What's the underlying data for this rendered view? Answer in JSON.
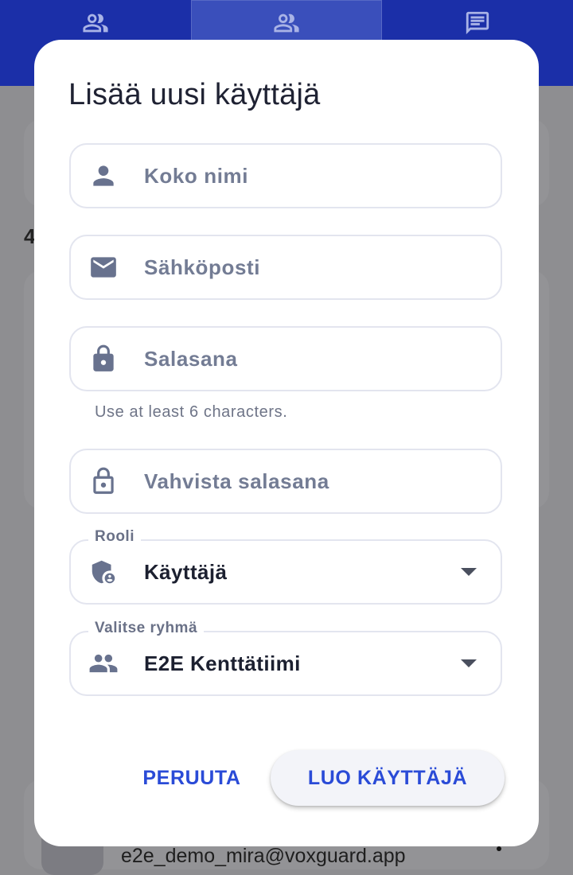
{
  "nav": {
    "tabs": [
      {
        "icon": "people-icon"
      },
      {
        "icon": "people-icon",
        "active": true
      },
      {
        "icon": "chat-icon"
      }
    ]
  },
  "background": {
    "partial_text": "4",
    "email": "e2e_demo_mira@voxguard.app"
  },
  "dialog": {
    "title": "Lisää uusi käyttäjä",
    "fields": {
      "full_name": {
        "placeholder": "Koko nimi",
        "icon": "person-icon"
      },
      "email": {
        "placeholder": "Sähköposti",
        "icon": "mail-icon"
      },
      "password": {
        "placeholder": "Salasana",
        "icon": "lock-icon",
        "helper": "Use at least 6 characters."
      },
      "confirm_password": {
        "placeholder": "Vahvista salasana",
        "icon": "lock-outline-icon"
      },
      "role": {
        "label": "Rooli",
        "value": "Käyttäjä",
        "icon": "shield-user-icon"
      },
      "group": {
        "label": "Valitse ryhmä",
        "value": "E2E Kenttätiimi",
        "icon": "group-icon"
      }
    },
    "actions": {
      "cancel": "PERUUTA",
      "create": "LUO KÄYTTÄJÄ"
    }
  },
  "colors": {
    "nav_bar": "#1b2fa8",
    "accent": "#2a4bd7",
    "field_border": "#e3e5ef",
    "icon": "#68728e"
  }
}
